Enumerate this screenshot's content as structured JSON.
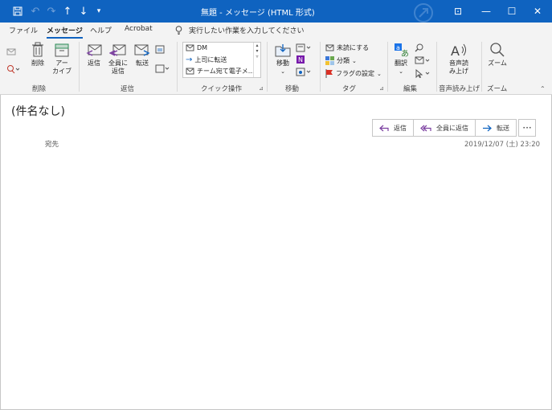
{
  "window": {
    "title": "無題 - メッセージ (HTML 形式)",
    "controls": {
      "ribbon_display": "⊡",
      "minimize": "—",
      "maximize": "☐",
      "close": "✕"
    }
  },
  "quick_access": [
    "save-icon",
    "undo-icon",
    "redo-icon",
    "up-arrow-icon",
    "down-arrow-icon",
    "customize-icon"
  ],
  "tabs": [
    "ファイル",
    "メッセージ",
    "ヘルプ",
    "Acrobat"
  ],
  "active_tab": "メッセージ",
  "tell_me": "実行したい作業を入力してください",
  "ribbon": {
    "delete_group": {
      "label": "削除",
      "delete": "削除",
      "archive_line1": "アー",
      "archive_line2": "カイブ"
    },
    "respond_group": {
      "label": "返信",
      "reply": "返信",
      "reply_all_line1": "全員に",
      "reply_all_line2": "返信",
      "forward": "転送"
    },
    "quick_steps": {
      "label": "クイック操作",
      "items": [
        "DM",
        "上司に転送",
        "チーム宛て電子メ..."
      ]
    },
    "move_group": {
      "label": "移動",
      "move": "移動"
    },
    "tags_group": {
      "label": "タグ",
      "unread": "未読にする",
      "categorize": "分類",
      "flag": "フラグの設定"
    },
    "editing_group": {
      "label": "編集",
      "translate": "翻訳"
    },
    "speech_group": {
      "label": "音声読み上げ",
      "read_line1": "音声読",
      "read_line2": "み上げ"
    },
    "zoom_group": {
      "label": "ズーム",
      "zoom": "ズーム"
    }
  },
  "message": {
    "subject": "(件名なし)",
    "to_label": "宛先",
    "date": "2019/12/07 (土) 23:20",
    "actions": {
      "reply": "返信",
      "reply_all": "全員に返信",
      "forward": "転送",
      "more": "···"
    }
  },
  "colors": {
    "title_bar": "#0f63c0",
    "accent": "#0f63c0",
    "ribbon_bg": "#f3f3f3"
  }
}
